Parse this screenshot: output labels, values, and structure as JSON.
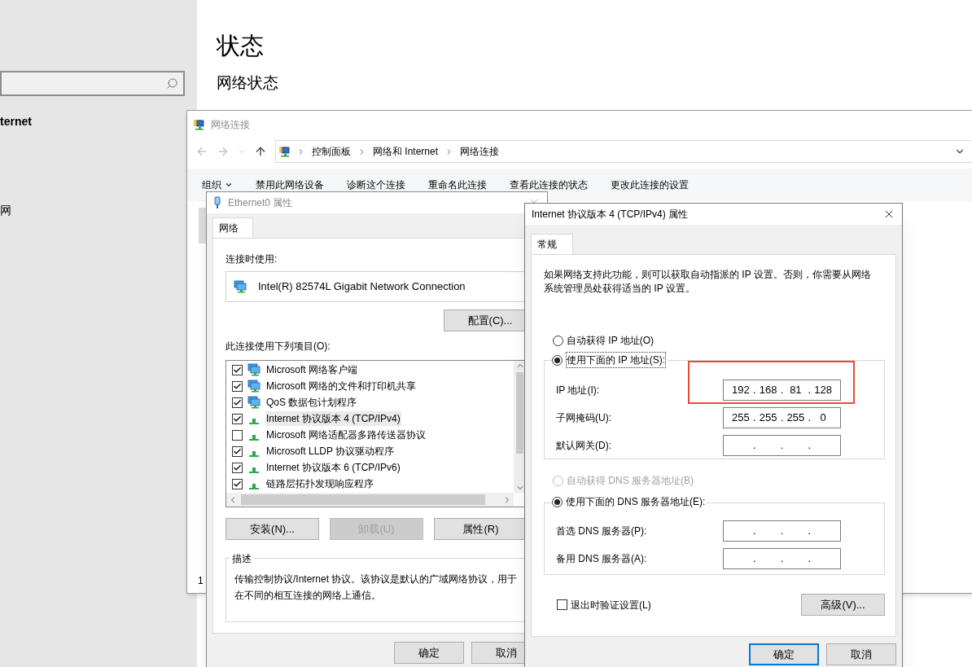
{
  "settings": {
    "sidebar": {
      "header": "ternet",
      "items": [
        {
          "label": "网"
        }
      ]
    },
    "main": {
      "title": "状态",
      "subtitle": "网络状态"
    }
  },
  "network_connections": {
    "window": {
      "title": "网络连接",
      "active": false
    },
    "breadcrumb": [
      "控制面板",
      "网络和 Internet",
      "网络连接"
    ],
    "toolbar": [
      {
        "label": "组织",
        "dropdown": true
      },
      {
        "label": "禁用此网络设备",
        "dropdown": false
      },
      {
        "label": "诊断这个连接",
        "dropdown": false
      },
      {
        "label": "重命名此连接",
        "dropdown": false
      },
      {
        "label": "查看此连接的状态",
        "dropdown": false
      },
      {
        "label": "更改此连接的设置",
        "dropdown": false
      }
    ],
    "status_bar": "1"
  },
  "ethernet_properties": {
    "window": {
      "title": "Ethernet0 属性",
      "active": false
    },
    "tabs": [
      {
        "label": "网络",
        "selected": true
      }
    ],
    "connect_using_label": "连接时使用:",
    "adapter": "Intel(R) 82574L Gigabit Network Connection",
    "configure_button": {
      "label": "配置(C)...",
      "disabled": false
    },
    "items_label": "此连接使用下列项目(O):",
    "items": [
      {
        "label": "Microsoft 网络客户端",
        "checked": true,
        "kind": "service",
        "selected": false
      },
      {
        "label": "Microsoft 网络的文件和打印机共享",
        "checked": true,
        "kind": "service",
        "selected": false
      },
      {
        "label": "QoS 数据包计划程序",
        "checked": true,
        "kind": "service",
        "selected": false
      },
      {
        "label": "Internet 协议版本 4 (TCP/IPv4)",
        "checked": true,
        "kind": "protocol",
        "selected": true
      },
      {
        "label": "Microsoft 网络适配器多路传送器协议",
        "checked": false,
        "kind": "protocol",
        "selected": false
      },
      {
        "label": "Microsoft LLDP 协议驱动程序",
        "checked": true,
        "kind": "protocol",
        "selected": false
      },
      {
        "label": "Internet 协议版本 6 (TCP/IPv6)",
        "checked": true,
        "kind": "protocol",
        "selected": false
      },
      {
        "label": "链路层拓扑发现响应程序",
        "checked": true,
        "kind": "protocol",
        "selected": false
      }
    ],
    "item_buttons": [
      {
        "label": "安装(N)...",
        "disabled": false
      },
      {
        "label": "卸载(U)",
        "disabled": true
      },
      {
        "label": "属性(R)",
        "disabled": false
      }
    ],
    "description": {
      "title": "描述",
      "text": "传输控制协议/Internet 协议。该协议是默认的广域网络协议，用于在不同的相互连接的网络上通信。"
    },
    "buttons": [
      {
        "label": "确定",
        "default": false
      },
      {
        "label": "取消",
        "default": false
      }
    ]
  },
  "ipv4_properties": {
    "window": {
      "title": "Internet 协议版本 4 (TCP/IPv4) 属性",
      "active": true
    },
    "tabs": [
      {
        "label": "常规",
        "selected": true
      }
    ],
    "intro": "如果网络支持此功能，则可以获取自动指派的 IP 设置。否则，你需要从网络系统管理员处获得适当的 IP 设置。",
    "ip_mode": [
      {
        "label": "自动获得 IP 地址(O)",
        "selected": false,
        "disabled": false
      },
      {
        "label": "使用下面的 IP 地址(S):",
        "selected": true,
        "disabled": false
      }
    ],
    "separator": ".",
    "ip_fields": [
      {
        "label": "IP 地址(I):",
        "octets": [
          "192",
          "168",
          "81",
          "128"
        ],
        "highlighted": true
      },
      {
        "label": "子网掩码(U):",
        "octets": [
          "255",
          "255",
          "255",
          "0"
        ],
        "highlighted": false
      },
      {
        "label": "默认网关(D):",
        "highlighted": false
      }
    ],
    "dns_mode": [
      {
        "label": "自动获得 DNS 服务器地址(B)",
        "selected": false,
        "disabled": true
      },
      {
        "label": "使用下面的 DNS 服务器地址(E):",
        "selected": true,
        "disabled": false
      }
    ],
    "dns_fields": [
      {
        "label": "首选 DNS 服务器(P):",
        "highlighted": false
      },
      {
        "label": "备用 DNS 服务器(A):",
        "highlighted": false
      }
    ],
    "validate": {
      "label": "退出时验证设置(L)",
      "checked": false
    },
    "advanced_button": {
      "label": "高级(V)...",
      "disabled": false
    },
    "buttons": [
      {
        "label": "确定",
        "default": true
      },
      {
        "label": "取消",
        "default": false
      }
    ]
  }
}
